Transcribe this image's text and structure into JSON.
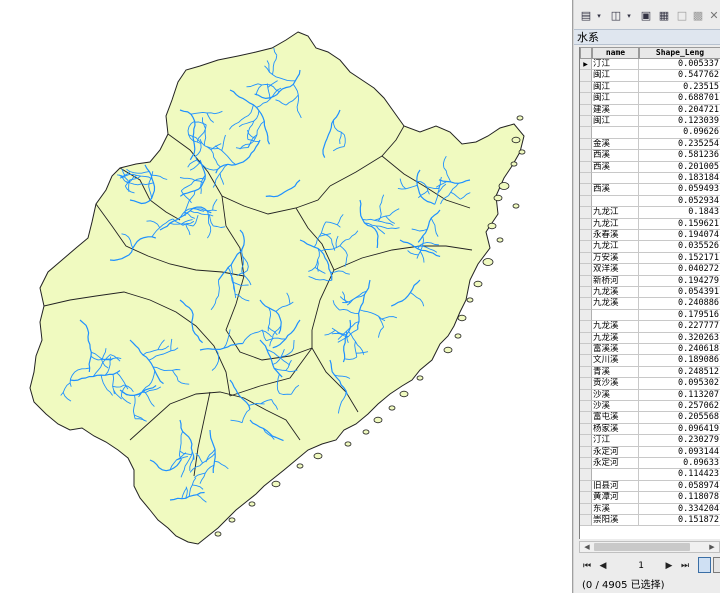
{
  "colors": {
    "land_fill": "#f0fac0",
    "boundary": "#222222",
    "river": "#1e90ff",
    "panel_bg": "#ececec",
    "title_bar_bg": "#dfe6ef"
  },
  "map": {
    "layers": [
      "province-boundary",
      "county-boundaries",
      "rivers",
      "islands"
    ]
  },
  "table": {
    "title": "水系",
    "columns": [
      "name",
      "Shape_Leng"
    ],
    "rows": [
      {
        "name": "汀江",
        "length": "0.005337",
        "current": true
      },
      {
        "name": "闽江",
        "length": "0.547762"
      },
      {
        "name": "闽江",
        "length": "0.23515"
      },
      {
        "name": "闽江",
        "length": "0.688701"
      },
      {
        "name": "建溪",
        "length": "0.204721"
      },
      {
        "name": "闽江",
        "length": "0.123039"
      },
      {
        "name": "",
        "length": "0.09626"
      },
      {
        "name": "金溪",
        "length": "0.235254"
      },
      {
        "name": "西溪",
        "length": "0.581236"
      },
      {
        "name": "西溪",
        "length": "0.201005"
      },
      {
        "name": "",
        "length": "0.183184"
      },
      {
        "name": "西溪",
        "length": "0.059493"
      },
      {
        "name": "",
        "length": "0.052934"
      },
      {
        "name": "九龙江",
        "length": "0.1843"
      },
      {
        "name": "九龙江",
        "length": "0.159621"
      },
      {
        "name": "永春溪",
        "length": "0.194074"
      },
      {
        "name": "九龙江",
        "length": "0.035526"
      },
      {
        "name": "万安溪",
        "length": "0.152171"
      },
      {
        "name": "双洋溪",
        "length": "0.040272"
      },
      {
        "name": "新桥河",
        "length": "0.194279"
      },
      {
        "name": "九龙溪",
        "length": "0.054391"
      },
      {
        "name": "九龙溪",
        "length": "0.240886"
      },
      {
        "name": "",
        "length": "0.179516"
      },
      {
        "name": "九龙溪",
        "length": "0.227777"
      },
      {
        "name": "九龙溪",
        "length": "0.320263"
      },
      {
        "name": "富溪溪",
        "length": "0.240618"
      },
      {
        "name": "文川溪",
        "length": "0.189086"
      },
      {
        "name": "青溪",
        "length": "0.248512"
      },
      {
        "name": "贡沙溪",
        "length": "0.095302"
      },
      {
        "name": "沙溪",
        "length": "0.113207"
      },
      {
        "name": "沙溪",
        "length": "0.257062"
      },
      {
        "name": "富屯溪",
        "length": "0.205568"
      },
      {
        "name": "杨家溪",
        "length": "0.096419"
      },
      {
        "name": "汀江",
        "length": "0.230279"
      },
      {
        "name": "永定河",
        "length": "0.093144"
      },
      {
        "name": "永定河",
        "length": "0.09633"
      },
      {
        "name": "",
        "length": "0.114423"
      },
      {
        "name": "旧县河",
        "length": "0.058974"
      },
      {
        "name": "黄潭河",
        "length": "0.118078"
      },
      {
        "name": "东溪",
        "length": "0.334204"
      },
      {
        "name": "崇阳溪",
        "length": "0.151872"
      }
    ]
  },
  "navigation": {
    "page": "1"
  },
  "status": {
    "text": "(0 / 4905 已选择)"
  }
}
